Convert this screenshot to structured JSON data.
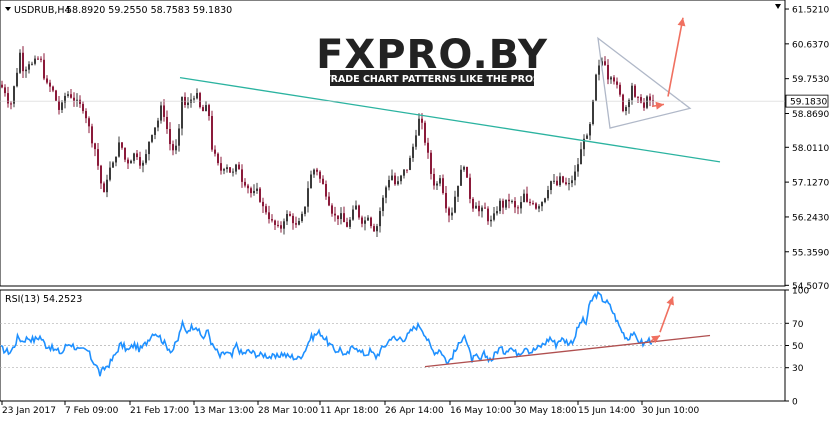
{
  "header": {
    "symbol": "USDRUB,H4",
    "ohlc": "58.8920 59.2550 58.7583 59.1830"
  },
  "logo": {
    "brand": "FXPRO.BY",
    "tagline": "TRADE CHART PATTERNS LIKE THE PROS"
  },
  "colors": {
    "bull": "#3b3b3b",
    "bear": "#8b1a3a",
    "trend_teal": "#2bb3a0",
    "triangle": "#b0b8c8",
    "arrow": "#f07060",
    "rsi_line": "#1e90ff",
    "rsi_trend": "#b05050",
    "price_tag_bg": "#ffffff"
  },
  "chart_data": [
    {
      "type": "candlestick",
      "title": "USDRUB,H4",
      "last_price": "59.1830",
      "ylim": [
        54.49,
        61.75
      ],
      "y_ticks": [
        "61.5210",
        "60.6370",
        "59.7530",
        "58.8690",
        "58.0110",
        "57.1270",
        "56.2430",
        "55.3590",
        "54.5070"
      ],
      "x_ticks": [
        "23 Jan 2017",
        "7 Feb 09:00",
        "21 Feb 17:00",
        "13 Mar 13:00",
        "28 Mar 10:00",
        "11 Apr 18:00",
        "26 Apr 14:00",
        "16 May 10:00",
        "30 May 18:00",
        "15 Jun 14:00",
        "30 Jun 10:00"
      ],
      "close_path": [
        [
          0,
          59.6
        ],
        [
          6,
          59.4
        ],
        [
          10,
          59.0
        ],
        [
          16,
          59.8
        ],
        [
          20,
          60.4
        ],
        [
          24,
          59.9
        ],
        [
          28,
          60.2
        ],
        [
          32,
          60.1
        ],
        [
          40,
          60.3
        ],
        [
          46,
          59.6
        ],
        [
          52,
          59.5
        ],
        [
          56,
          59.2
        ],
        [
          60,
          58.9
        ],
        [
          66,
          59.4
        ],
        [
          72,
          59.3
        ],
        [
          78,
          59.1
        ],
        [
          84,
          59.0
        ],
        [
          88,
          58.6
        ],
        [
          92,
          58.2
        ],
        [
          96,
          57.9
        ],
        [
          100,
          57.2
        ],
        [
          104,
          56.8
        ],
        [
          108,
          57.4
        ],
        [
          114,
          57.6
        ],
        [
          118,
          58.1
        ],
        [
          122,
          58.0
        ],
        [
          126,
          57.6
        ],
        [
          130,
          57.7
        ],
        [
          136,
          57.9
        ],
        [
          142,
          57.5
        ],
        [
          146,
          57.8
        ],
        [
          150,
          58.3
        ],
        [
          154,
          58.5
        ],
        [
          158,
          58.7
        ],
        [
          162,
          59.1
        ],
        [
          166,
          58.6
        ],
        [
          170,
          58.1
        ],
        [
          174,
          57.9
        ],
        [
          178,
          58.1
        ],
        [
          182,
          59.3
        ],
        [
          186,
          59.0
        ],
        [
          190,
          59.2
        ],
        [
          196,
          59.4
        ],
        [
          200,
          59.0
        ],
        [
          204,
          58.9
        ],
        [
          208,
          59.1
        ],
        [
          212,
          58.0
        ],
        [
          216,
          57.7
        ],
        [
          220,
          57.4
        ],
        [
          226,
          57.6
        ],
        [
          232,
          57.3
        ],
        [
          238,
          57.6
        ],
        [
          242,
          57.2
        ],
        [
          246,
          57.1
        ],
        [
          252,
          56.8
        ],
        [
          258,
          56.9
        ],
        [
          262,
          56.5
        ],
        [
          266,
          56.4
        ],
        [
          272,
          56.1
        ],
        [
          276,
          56.0
        ],
        [
          280,
          55.9
        ],
        [
          284,
          56.2
        ],
        [
          288,
          56.3
        ],
        [
          292,
          56.2
        ],
        [
          296,
          56.0
        ],
        [
          300,
          56.1
        ],
        [
          304,
          56.4
        ],
        [
          308,
          57.0
        ],
        [
          312,
          57.4
        ],
        [
          316,
          57.5
        ],
        [
          320,
          57.2
        ],
        [
          324,
          57.0
        ],
        [
          328,
          56.7
        ],
        [
          332,
          56.4
        ],
        [
          336,
          56.2
        ],
        [
          340,
          56.3
        ],
        [
          344,
          56.1
        ],
        [
          348,
          56.0
        ],
        [
          352,
          56.3
        ],
        [
          356,
          56.5
        ],
        [
          360,
          56.2
        ],
        [
          364,
          56.1
        ],
        [
          368,
          56.3
        ],
        [
          372,
          56.0
        ],
        [
          376,
          55.9
        ],
        [
          380,
          56.4
        ],
        [
          384,
          56.8
        ],
        [
          388,
          57.2
        ],
        [
          392,
          57.3
        ],
        [
          396,
          57.0
        ],
        [
          400,
          57.2
        ],
        [
          404,
          57.4
        ],
        [
          408,
          57.5
        ],
        [
          412,
          57.9
        ],
        [
          416,
          58.4
        ],
        [
          420,
          58.8
        ],
        [
          424,
          58.3
        ],
        [
          428,
          57.8
        ],
        [
          432,
          57.2
        ],
        [
          436,
          57.0
        ],
        [
          440,
          57.3
        ],
        [
          444,
          56.8
        ],
        [
          448,
          56.3
        ],
        [
          452,
          56.4
        ],
        [
          456,
          56.9
        ],
        [
          460,
          57.3
        ],
        [
          464,
          57.6
        ],
        [
          468,
          57.0
        ],
        [
          472,
          56.5
        ],
        [
          476,
          56.6
        ],
        [
          480,
          56.3
        ],
        [
          484,
          56.5
        ],
        [
          488,
          56.2
        ],
        [
          492,
          56.1
        ],
        [
          496,
          56.4
        ],
        [
          500,
          56.6
        ],
        [
          504,
          56.5
        ],
        [
          508,
          56.7
        ],
        [
          512,
          56.6
        ],
        [
          516,
          56.4
        ],
        [
          520,
          56.5
        ],
        [
          524,
          56.8
        ],
        [
          528,
          56.5
        ],
        [
          532,
          56.7
        ],
        [
          536,
          56.5
        ],
        [
          540,
          56.6
        ],
        [
          544,
          56.7
        ],
        [
          548,
          57.0
        ],
        [
          552,
          57.2
        ],
        [
          556,
          57.0
        ],
        [
          560,
          57.2
        ],
        [
          564,
          57.1
        ],
        [
          568,
          57.0
        ],
        [
          572,
          57.2
        ],
        [
          576,
          57.4
        ],
        [
          580,
          57.8
        ],
        [
          584,
          58.3
        ],
        [
          588,
          58.2
        ],
        [
          592,
          58.9
        ],
        [
          596,
          59.8
        ],
        [
          600,
          60.1
        ],
        [
          604,
          60.3
        ],
        [
          608,
          59.8
        ],
        [
          612,
          59.9
        ],
        [
          616,
          59.6
        ],
        [
          620,
          59.3
        ],
        [
          624,
          58.9
        ],
        [
          628,
          59.2
        ],
        [
          632,
          59.6
        ],
        [
          636,
          59.1
        ],
        [
          640,
          59.3
        ],
        [
          644,
          59.0
        ],
        [
          648,
          59.3
        ],
        [
          652,
          59.1
        ],
        [
          655,
          59.18
        ]
      ],
      "annotations": {
        "trendline": [
          [
            180,
            59.78
          ],
          [
            720,
            57.64
          ]
        ],
        "triangle": [
          [
            598,
            60.78
          ],
          [
            690,
            59.0
          ],
          [
            610,
            58.5
          ]
        ],
        "arrows": [
          {
            "from": [
              652,
              59.05
            ],
            "to": [
              664,
              59.1
            ]
          },
          {
            "from": [
              668,
              59.3
            ],
            "to": [
              683,
              61.3
            ]
          }
        ]
      }
    },
    {
      "type": "line",
      "title": "RSI(13) 54.2523",
      "ylim": [
        0,
        100
      ],
      "y_ticks": [
        "100",
        "70",
        "50",
        "30",
        "0"
      ],
      "hlines": [
        70,
        50,
        30
      ],
      "values_path": [
        [
          0,
          48
        ],
        [
          6,
          45
        ],
        [
          10,
          44
        ],
        [
          14,
          49
        ],
        [
          18,
          58
        ],
        [
          22,
          54
        ],
        [
          28,
          57
        ],
        [
          34,
          55
        ],
        [
          40,
          58
        ],
        [
          46,
          50
        ],
        [
          50,
          49
        ],
        [
          54,
          46
        ],
        [
          58,
          45
        ],
        [
          62,
          43
        ],
        [
          66,
          50
        ],
        [
          70,
          52
        ],
        [
          76,
          48
        ],
        [
          80,
          45
        ],
        [
          84,
          46
        ],
        [
          88,
          45
        ],
        [
          92,
          37
        ],
        [
          96,
          33
        ],
        [
          100,
          24
        ],
        [
          104,
          29
        ],
        [
          110,
          34
        ],
        [
          116,
          43
        ],
        [
          120,
          51
        ],
        [
          124,
          49
        ],
        [
          128,
          45
        ],
        [
          134,
          51
        ],
        [
          140,
          46
        ],
        [
          146,
          52
        ],
        [
          150,
          58
        ],
        [
          154,
          62
        ],
        [
          158,
          60
        ],
        [
          162,
          55
        ],
        [
          166,
          50
        ],
        [
          172,
          45
        ],
        [
          178,
          55
        ],
        [
          182,
          70
        ],
        [
          186,
          62
        ],
        [
          190,
          66
        ],
        [
          196,
          68
        ],
        [
          200,
          60
        ],
        [
          204,
          57
        ],
        [
          208,
          64
        ],
        [
          212,
          50
        ],
        [
          216,
          46
        ],
        [
          220,
          40
        ],
        [
          226,
          44
        ],
        [
          232,
          40
        ],
        [
          236,
          51
        ],
        [
          242,
          42
        ],
        [
          248,
          45
        ],
        [
          254,
          43
        ],
        [
          260,
          41
        ],
        [
          264,
          42
        ],
        [
          270,
          40
        ],
        [
          276,
          39
        ],
        [
          282,
          43
        ],
        [
          288,
          40
        ],
        [
          292,
          40
        ],
        [
          298,
          38
        ],
        [
          304,
          44
        ],
        [
          310,
          56
        ],
        [
          316,
          60
        ],
        [
          320,
          62
        ],
        [
          326,
          55
        ],
        [
          332,
          48
        ],
        [
          336,
          45
        ],
        [
          340,
          47
        ],
        [
          346,
          40
        ],
        [
          352,
          48
        ],
        [
          356,
          50
        ],
        [
          360,
          44
        ],
        [
          366,
          42
        ],
        [
          370,
          45
        ],
        [
          376,
          40
        ],
        [
          382,
          47
        ],
        [
          388,
          53
        ],
        [
          392,
          59
        ],
        [
          396,
          54
        ],
        [
          400,
          57
        ],
        [
          404,
          56
        ],
        [
          408,
          59
        ],
        [
          412,
          64
        ],
        [
          416,
          67
        ],
        [
          420,
          68
        ],
        [
          424,
          62
        ],
        [
          428,
          54
        ],
        [
          432,
          46
        ],
        [
          436,
          44
        ],
        [
          440,
          47
        ],
        [
          444,
          40
        ],
        [
          448,
          34
        ],
        [
          452,
          40
        ],
        [
          456,
          46
        ],
        [
          460,
          52
        ],
        [
          464,
          62
        ],
        [
          468,
          48
        ],
        [
          472,
          37
        ],
        [
          476,
          40
        ],
        [
          480,
          36
        ],
        [
          484,
          42
        ],
        [
          488,
          39
        ],
        [
          492,
          37
        ],
        [
          496,
          44
        ],
        [
          500,
          48
        ],
        [
          504,
          44
        ],
        [
          510,
          49
        ],
        [
          516,
          43
        ],
        [
          522,
          45
        ],
        [
          526,
          50
        ],
        [
          530,
          44
        ],
        [
          536,
          47
        ],
        [
          540,
          49
        ],
        [
          546,
          53
        ],
        [
          550,
          57
        ],
        [
          556,
          51
        ],
        [
          560,
          56
        ],
        [
          566,
          54
        ],
        [
          570,
          52
        ],
        [
          574,
          56
        ],
        [
          578,
          66
        ],
        [
          582,
          73
        ],
        [
          586,
          70
        ],
        [
          590,
          88
        ],
        [
          594,
          94
        ],
        [
          598,
          97
        ],
        [
          602,
          92
        ],
        [
          608,
          88
        ],
        [
          612,
          82
        ],
        [
          616,
          74
        ],
        [
          620,
          66
        ],
        [
          624,
          60
        ],
        [
          628,
          56
        ],
        [
          632,
          62
        ],
        [
          636,
          56
        ],
        [
          640,
          54
        ],
        [
          644,
          51
        ],
        [
          648,
          55
        ],
        [
          652,
          54
        ]
      ],
      "annotations": {
        "trendline": [
          [
            425,
            31
          ],
          [
            710,
            59
          ]
        ],
        "arrows": [
          {
            "from": [
              651,
              54
            ],
            "to": [
              660,
              59
            ]
          },
          {
            "from": [
              660,
              62
            ],
            "to": [
              673,
              94
            ]
          }
        ]
      }
    }
  ]
}
